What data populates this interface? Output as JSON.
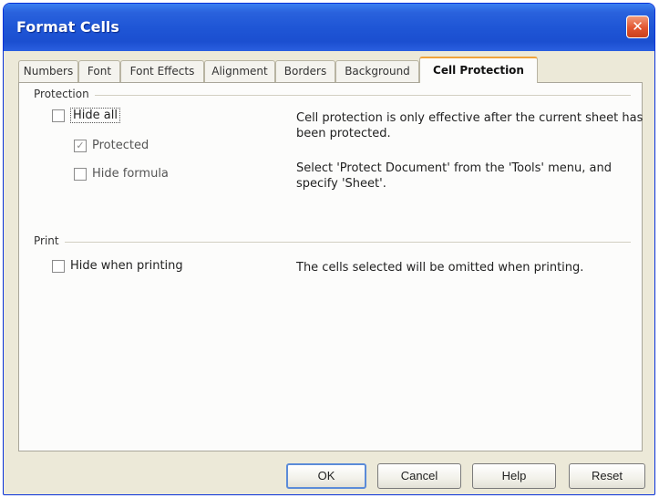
{
  "window": {
    "title": "Format Cells"
  },
  "tabs": [
    {
      "label": "Numbers"
    },
    {
      "label": "Font"
    },
    {
      "label": "Font Effects"
    },
    {
      "label": "Alignment"
    },
    {
      "label": "Borders"
    },
    {
      "label": "Background"
    },
    {
      "label": "Cell Protection",
      "active": true
    }
  ],
  "protection": {
    "group_label": "Protection",
    "hide_all": {
      "label": "Hide all",
      "checked": false
    },
    "protected": {
      "label": "Protected",
      "checked": true
    },
    "hide_formula": {
      "label": "Hide formula",
      "checked": false
    },
    "desc1": "Cell protection is only effective after the current sheet has been protected.",
    "desc2": "Select 'Protect Document' from the 'Tools' menu, and specify 'Sheet'."
  },
  "print": {
    "group_label": "Print",
    "hide_when_printing": {
      "label": "Hide when printing",
      "checked": false
    },
    "desc": "The cells selected will be omitted when printing."
  },
  "buttons": {
    "ok": "OK",
    "cancel": "Cancel",
    "help": "Help",
    "reset": "Reset"
  },
  "icons": {
    "close": "close-icon",
    "checkmark": "checkmark-icon"
  },
  "colors": {
    "titlebar": "#1f56d6",
    "active_tab_accent": "#f0a33a",
    "dialog_bg": "#ece9d8"
  }
}
